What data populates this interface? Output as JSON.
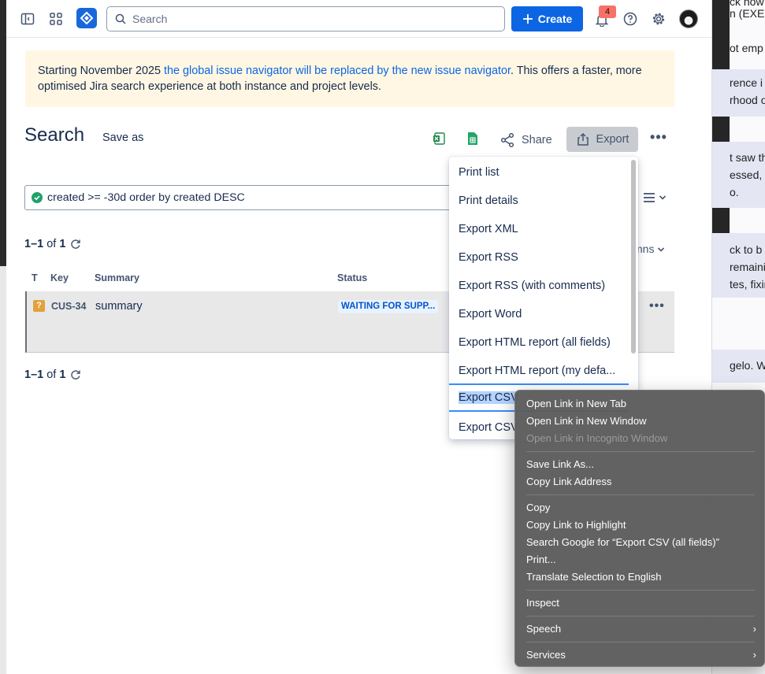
{
  "topnav": {
    "search_placeholder": "Search",
    "create_label": "Create",
    "notification_count": "4"
  },
  "banner": {
    "text_before": "Starting November 2025 ",
    "link_text": "the global issue navigator will be replaced by the new issue navigator",
    "text_after": ". This offers a faster, more optimised Jira search experience at both instance and project levels."
  },
  "page": {
    "title": "Search",
    "save_as": "Save as",
    "share_label": "Share",
    "export_label": "Export"
  },
  "jql": {
    "query": "created >= -30d order by created DESC"
  },
  "results": {
    "count_prefix": "1–1",
    "count_of": " of ",
    "count_total": "1",
    "columns_label": "mns"
  },
  "table": {
    "headers": {
      "type": "T",
      "key": "Key",
      "summary": "Summary",
      "status": "Status"
    },
    "rows": [
      {
        "type_icon": "?",
        "key": "CUS-34",
        "summary": "summary",
        "status": "WAITING FOR SUPP..."
      }
    ]
  },
  "export_menu": {
    "items": [
      "Print list",
      "Print details",
      "Export XML",
      "Export RSS",
      "Export RSS (with comments)",
      "Export Word",
      "Export HTML report (all fields)",
      "Export HTML report (my defa...",
      "Export CSV",
      "Export CSV"
    ],
    "focused_index": 8
  },
  "context_menu": {
    "open_new_tab": "Open Link in New Tab",
    "open_new_window": "Open Link in New Window",
    "open_incognito": "Open Link in Incognito Window",
    "save_link_as": "Save Link As...",
    "copy_link_address": "Copy Link Address",
    "copy": "Copy",
    "copy_link_highlight": "Copy Link to Highlight",
    "search_google": "Search Google for “Export CSV (all fields)”",
    "print": "Print...",
    "translate": "Translate Selection to English",
    "inspect": "Inspect",
    "speech": "Speech",
    "services": "Services"
  },
  "background_text": {
    "l1": "ck now",
    "l2": "n (EXE,S",
    "l3": "ot emp",
    "l4": "rence i",
    "l5": "rhood o",
    "l6": "t saw th",
    "l7": "essed, s",
    "l8": "o.",
    "l9": "ck to b",
    "l10": "remaining",
    "l11": "tes, fixing",
    "l12": "gelo. We a"
  },
  "colors": {
    "brand_blue": "#0c66e4",
    "banner_bg": "#fff7e3",
    "status_bg": "#e9f2ff",
    "status_text": "#0055cc",
    "badge": "#f87168"
  }
}
